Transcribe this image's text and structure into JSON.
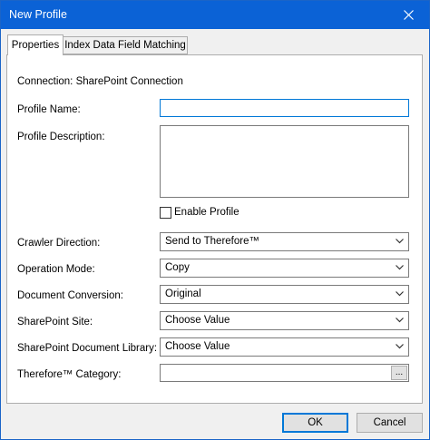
{
  "window": {
    "title": "New Profile"
  },
  "tabs": [
    {
      "label": "Properties",
      "active": true
    },
    {
      "label": "Index Data Field Matching",
      "active": false
    }
  ],
  "form": {
    "connection_label": "Connection: SharePoint Connection",
    "profile_name_label": "Profile Name:",
    "profile_name_value": "",
    "profile_description_label": "Profile Description:",
    "profile_description_value": "",
    "enable_profile_label": "Enable Profile",
    "enable_profile_checked": false,
    "crawler_direction_label": "Crawler Direction:",
    "crawler_direction_value": "Send to Therefore™",
    "operation_mode_label": "Operation Mode:",
    "operation_mode_value": "Copy",
    "document_conversion_label": "Document Conversion:",
    "document_conversion_value": "Original",
    "sharepoint_site_label": "SharePoint Site:",
    "sharepoint_site_value": "Choose Value",
    "sharepoint_library_label": "SharePoint Document Library:",
    "sharepoint_library_value": "Choose Value",
    "therefore_category_label": "Therefore™ Category:",
    "therefore_category_value": "",
    "browse_label": "..."
  },
  "buttons": {
    "ok": "OK",
    "cancel": "Cancel"
  },
  "colors": {
    "titlebar": "#0b62d6",
    "focus": "#0078d7",
    "dialog_bg": "#f0f0f0"
  }
}
